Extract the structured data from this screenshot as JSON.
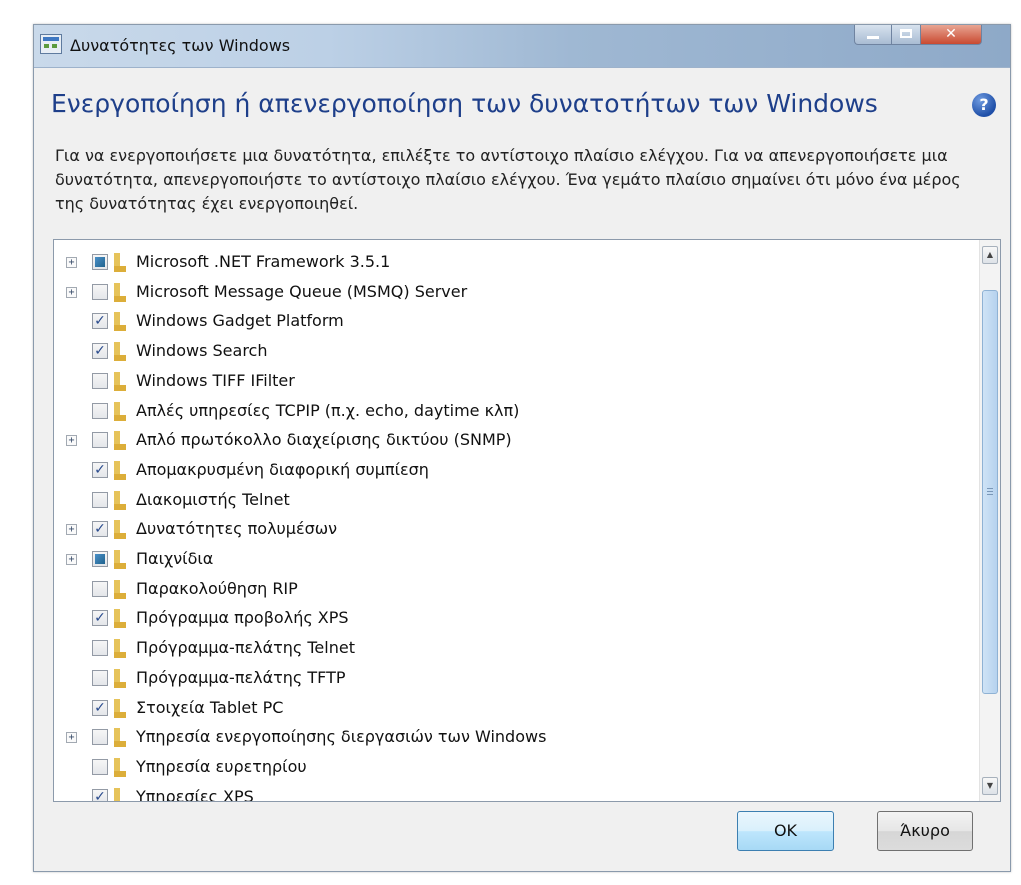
{
  "window": {
    "title": "Δυνατότητες των Windows"
  },
  "heading": "Ενεργοποίηση ή απενεργοποίηση των δυνατοτήτων των Windows",
  "help_icon": "help-icon",
  "description": "Για να ενεργοποιήσετε μια δυνατότητα, επιλέξτε το αντίστοιχο πλαίσιο ελέγχου. Για να απενεργοποιήσετε μια δυνατότητα, απενεργοποιήστε το αντίστοιχο πλαίσιο ελέγχου. Ένα γεμάτο πλαίσιο σημαίνει ότι μόνο ένα μέρος της δυνατότητας έχει ενεργοποιηθεί.",
  "features": [
    {
      "label": "Microsoft .NET Framework 3.5.1",
      "expandable": true,
      "state": "partial"
    },
    {
      "label": "Microsoft Message Queue (MSMQ) Server",
      "expandable": true,
      "state": "unchecked"
    },
    {
      "label": "Windows Gadget Platform",
      "expandable": false,
      "state": "checked"
    },
    {
      "label": "Windows Search",
      "expandable": false,
      "state": "checked"
    },
    {
      "label": "Windows TIFF IFilter",
      "expandable": false,
      "state": "unchecked"
    },
    {
      "label": "Απλές υπηρεσίες TCPIP (π.χ. echo, daytime κλπ)",
      "expandable": false,
      "state": "unchecked"
    },
    {
      "label": "Απλό πρωτόκολλο διαχείρισης δικτύου (SNMP)",
      "expandable": true,
      "state": "unchecked"
    },
    {
      "label": "Απομακρυσμένη διαφορική συμπίεση",
      "expandable": false,
      "state": "checked"
    },
    {
      "label": "Διακομιστής Telnet",
      "expandable": false,
      "state": "unchecked"
    },
    {
      "label": "Δυνατότητες πολυμέσων",
      "expandable": true,
      "state": "checked"
    },
    {
      "label": "Παιχνίδια",
      "expandable": true,
      "state": "partial"
    },
    {
      "label": "Παρακολούθηση RIP",
      "expandable": false,
      "state": "unchecked"
    },
    {
      "label": "Πρόγραμμα προβολής XPS",
      "expandable": false,
      "state": "checked"
    },
    {
      "label": "Πρόγραμμα-πελάτης Telnet",
      "expandable": false,
      "state": "unchecked"
    },
    {
      "label": "Πρόγραμμα-πελάτης TFTP",
      "expandable": false,
      "state": "unchecked"
    },
    {
      "label": "Στοιχεία Tablet PC",
      "expandable": false,
      "state": "checked"
    },
    {
      "label": "Υπηρεσία ενεργοποίησης διεργασιών των Windows",
      "expandable": true,
      "state": "unchecked"
    },
    {
      "label": "Υπηρεσία ευρετηρίου",
      "expandable": false,
      "state": "unchecked"
    },
    {
      "label": "Υπηρεσίες XPS",
      "expandable": false,
      "state": "checked"
    }
  ],
  "buttons": {
    "ok": "OK",
    "cancel": "Άκυρο"
  },
  "colors": {
    "heading": "#1e3f8a",
    "partial_fill": "#21648f",
    "checkmark": "#2a4b8d"
  }
}
